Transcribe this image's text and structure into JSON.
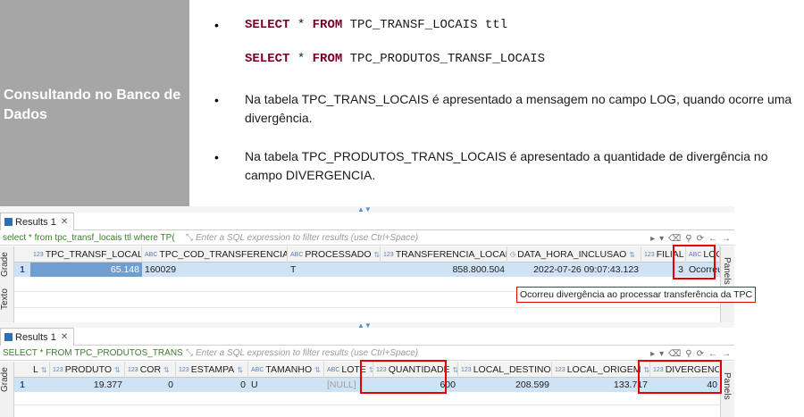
{
  "doc": {
    "left_title": "Consultando no Banco de Dados",
    "sql1": {
      "kw1": "SELECT",
      "star": " * ",
      "kw2": "FROM",
      "rest": " TPC_TRANSF_LOCAIS ttl"
    },
    "sql2": {
      "kw1": "SELECT",
      "star": " * ",
      "kw2": "FROM",
      "rest": " TPC_PRODUTOS_TRANSF_LOCAIS"
    },
    "para1": "Na tabela TPC_TRANS_LOCAIS é apresentado a mensagem no campo LOG, quando ocorre uma divergência.",
    "para2": "Na tabela TPC_PRODUTOS_TRANS_LOCAIS é apresentado a quantidade de divergência no campo DIVERGENCIA.",
    "bullet": "•"
  },
  "panel1": {
    "tab_label": "Results 1",
    "filter_sql": "select * from tpc_transf_locais ttl where TP(",
    "filter_placeholder": "Enter a SQL expression to filter results (use Ctrl+Space)",
    "side_tab_grid": "Grade",
    "side_tab_text": "Texto",
    "panels_label": "Panels",
    "columns": [
      "TPC_TRANSF_LOCAL",
      "TPC_COD_TRANSFERENCIA",
      "PROCESSADO",
      "TRANSFERENCIA_LOCAL",
      "DATA_HORA_INCLUSAO",
      "FILIAL",
      "LOG"
    ],
    "column_types": [
      "123",
      "ABC",
      "ABC",
      "123",
      "◷",
      "123",
      "ABC"
    ],
    "row": {
      "num": "1",
      "cells": [
        "65.148",
        "160029",
        "T",
        "858.800.504",
        "2022-07-26 09:07:43.123",
        "3",
        "Ocorreu di"
      ]
    },
    "tooltip": "Ocorreu divergência ao processar transferência da TPC"
  },
  "panel2": {
    "tab_label": "Results 1",
    "filter_sql": "SELECT * FROM TPC_PRODUTOS_TRANSF_",
    "filter_placeholder": "Enter a SQL expression to filter results (use Ctrl+Space)",
    "side_tab_grid": "Grade",
    "panels_label": "Panels",
    "columns": [
      "L",
      "PRODUTO",
      "COR",
      "ESTAMPA",
      "TAMANHO",
      "LOTE",
      "QUANTIDADE",
      "LOCAL_DESTINO",
      "LOCAL_ORIGEM",
      "DIVERGENCIA"
    ],
    "column_types": [
      "",
      "123",
      "123",
      "123",
      "ABC",
      "ABC",
      "123",
      "123",
      "123",
      "123"
    ],
    "row": {
      "num": "1",
      "cells": [
        "",
        "19.377",
        "0",
        "0",
        "U",
        "[NULL]",
        "600",
        "208.599",
        "133.717",
        "40"
      ]
    }
  },
  "colors": {
    "highlight": "#e20000",
    "selected_row": "#cfe3f5",
    "doc_panel": "#a6a6a6",
    "sql_keyword": "#7a0026"
  }
}
